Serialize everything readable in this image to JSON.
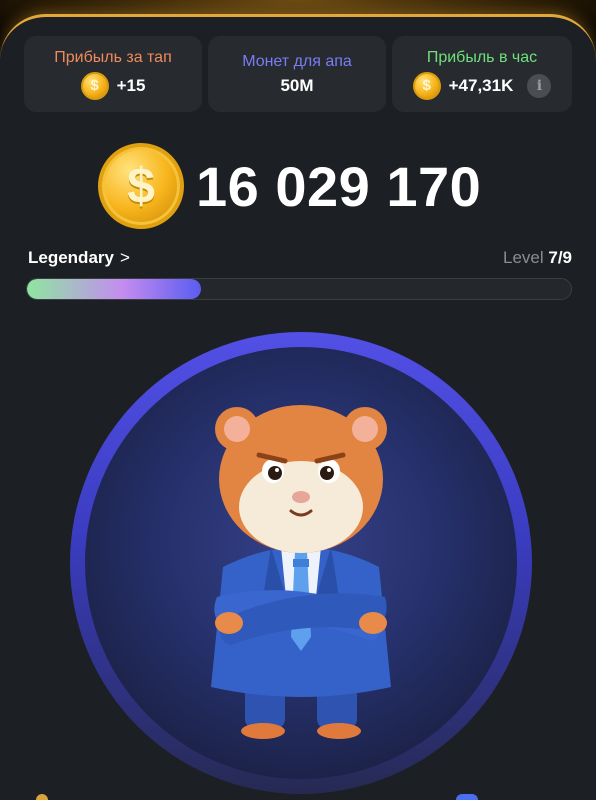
{
  "stats": [
    {
      "title": "Прибыль за тап",
      "title_color": "#f08a5d",
      "value": "+15",
      "icon": "coin-icon"
    },
    {
      "title": "Монет для апа",
      "title_color": "#7a7cf5",
      "value": "50M"
    },
    {
      "title": "Прибыль в час",
      "title_color": "#6ee07a",
      "value": "+47,31K",
      "icon": "coin-icon",
      "info_icon": "i"
    }
  ],
  "balance": {
    "value": "16 029 170",
    "icon": "coin-icon"
  },
  "league": {
    "name": "Legendary",
    "chevron": ">"
  },
  "level": {
    "label": "Level",
    "value": "7/9",
    "progress_fraction": 0.32
  },
  "coin_symbol": "$",
  "character": "hamster-ceo-icon"
}
